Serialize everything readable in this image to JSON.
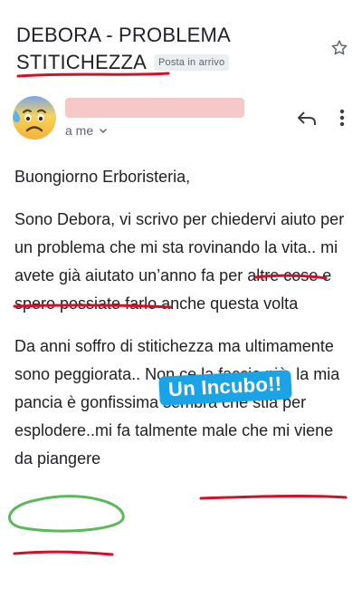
{
  "email": {
    "subject_line1": "DEBORA - PROBLEMA",
    "subject_line2": "STITICHEZZA",
    "label_badge": "Posta in arrivo",
    "recipient": "a me",
    "body_paragraphs": [
      "Buongiorno Erboristeria,",
      "Sono Debora, vi scrivo per chiedervi aiuto per un problema che mi sta rovinando la vita.. mi avete già aiutato un’anno fa per altre cose e spero possiate farlo anche questa volta",
      "Da anni soffro di stitichezza ma ultimamente sono peggiorata.. Non ce la faccio più, la mia pancia è gonfissima sembra che stia per esplodere..mi fa talmente male che mi viene da piangere"
    ]
  },
  "overlay": {
    "sticker_text": "Un Incubo!!"
  },
  "icons": {
    "star": "star-outline-icon",
    "reply": "reply-icon",
    "more": "more-vert-icon",
    "avatar": "anxious-sweat-emoji",
    "chevron": "chevron-down-icon"
  },
  "colors": {
    "text": "#202124",
    "muted": "#5f6368",
    "underline_red": "#d0112b",
    "circle_green": "#5cb85c",
    "sticker_blue": "#1ba3e8",
    "name_mask_pink": "#f6c9c9"
  }
}
